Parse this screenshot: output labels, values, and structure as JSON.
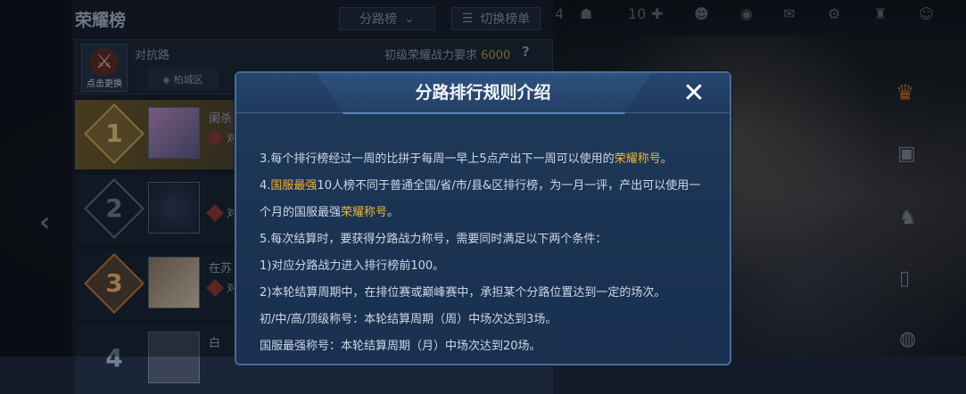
{
  "panel": {
    "title": "荣耀榜",
    "dropdown_label": "分路榜",
    "switch_label": "切换榜单",
    "route_name": "对抗路",
    "route_icon_caption": "点击更换",
    "region_tab": "柏城区",
    "requirement_label": "初级荣耀战力要求",
    "requirement_value": "6000",
    "help_label": "?"
  },
  "rows": [
    {
      "rank": "1",
      "name": "阑杀",
      "label": "对"
    },
    {
      "rank": "2",
      "name": "",
      "label": "对"
    },
    {
      "rank": "3",
      "name": "在苏",
      "label": "对"
    },
    {
      "rank": "4",
      "name": "白",
      "label": ""
    }
  ],
  "top_bar": {
    "count_a": "4",
    "count_b": "10"
  },
  "modal": {
    "title": "分路排行规则介绍",
    "close_label": "✕",
    "rule3_prefix": "3.每个排行榜经过一周的比拼于每周一早上5点产出下一周可以使用的",
    "rule3_highlight": "荣耀称号",
    "rule3_suffix": "。",
    "rule4_highlight": "国服最强",
    "rule4_text": "10人榜不同于普通全国/省/市/县&区排行榜，为一月一评，产出可以使用一",
    "rule4_line2_prefix": "个月的国服最强",
    "rule4_line2_highlight": "荣耀称号",
    "rule4_line2_suffix": "。",
    "rule5": "5.每次结算时，要获得分路战力称号，需要同时满足以下两个条件：",
    "cond1": "1)对应分路战力进入排行榜前100。",
    "cond2": "2)本轮结算周期中，在排位赛或巅峰赛中，承担某个分路位置达到一定的场次。",
    "cond3": "初/中/高/顶级称号：本轮结算周期（周）中场次达到3场。",
    "cond4": "国服最强称号：本轮结算周期（月）中场次达到20场。"
  }
}
